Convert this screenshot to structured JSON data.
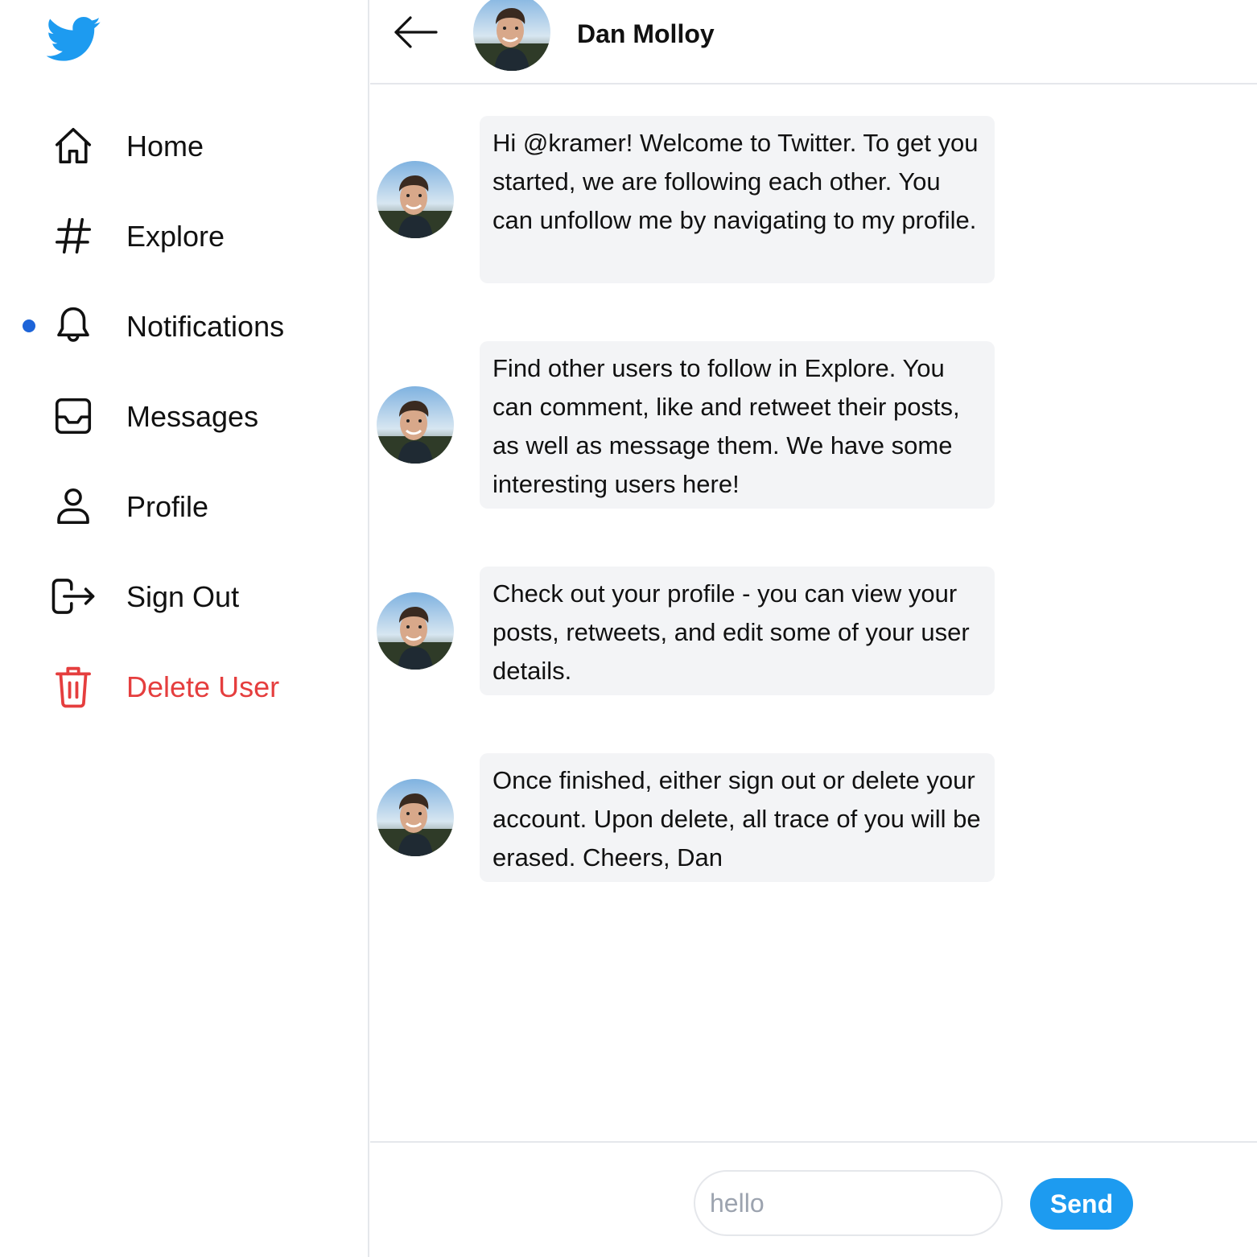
{
  "brand": {
    "logo_icon": "twitter-bird-icon",
    "color": "#1d9bf0"
  },
  "sidebar": {
    "items": [
      {
        "label": "Home",
        "icon": "home-icon"
      },
      {
        "label": "Explore",
        "icon": "hashtag-icon"
      },
      {
        "label": "Notifications",
        "icon": "bell-icon",
        "unread": true
      },
      {
        "label": "Messages",
        "icon": "inbox-icon"
      },
      {
        "label": "Profile",
        "icon": "user-icon"
      },
      {
        "label": "Sign Out",
        "icon": "logout-icon"
      },
      {
        "label": "Delete User",
        "icon": "trash-icon",
        "color": "#e53e3e"
      }
    ],
    "notification_dot_color": "#1d64d8"
  },
  "conversation": {
    "name": "Dan Molloy",
    "back_icon": "arrow-left-icon",
    "messages": [
      {
        "text": "Hi @kramer! Welcome to Twitter. To get you started, we are following each other. You can unfollow me by navigating to my profile."
      },
      {
        "text": "Find other users to follow in Explore. You can comment, like and retweet their posts, as well as message them. We have some interesting users here!"
      },
      {
        "text": "Check out your profile - you can view your posts, retweets, and edit some of your user details."
      },
      {
        "text": "Once finished, either sign out or delete your account. Upon delete, all trace of you will be erased. Cheers, Dan"
      }
    ]
  },
  "composer": {
    "placeholder": "hello",
    "value": "",
    "send_label": "Send",
    "send_color": "#1d9bf0"
  }
}
